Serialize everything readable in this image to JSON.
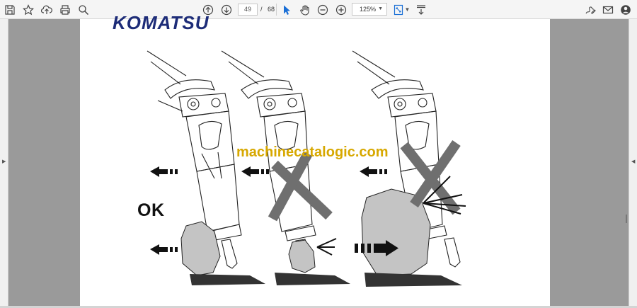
{
  "toolbar": {
    "save_label": "",
    "current_page": "49",
    "page_separator": "/",
    "total_pages": "68",
    "zoom_level": "125%",
    "accent_color": "#1a6fd6"
  },
  "icons": {
    "save": "save-icon",
    "bookmark": "star-icon",
    "upload": "cloud-upload-icon",
    "print": "print-icon",
    "search": "search-icon",
    "prev_page": "arrow-up-circle-icon",
    "next_page": "arrow-down-circle-icon",
    "select": "cursor-arrow-icon",
    "pan": "hand-icon",
    "zoom_out": "zoom-out-icon",
    "zoom_in": "zoom-in-icon",
    "fit": "fit-page-icon",
    "scroll_mode": "scroll-mode-icon",
    "sign": "sign-icon",
    "email": "email-icon",
    "account": "account-icon"
  },
  "document": {
    "header_fragment": "KOMATSU",
    "ok_label": "OK",
    "watermark": "machinecatalogic.com",
    "watermark_color": "#d7a800"
  }
}
